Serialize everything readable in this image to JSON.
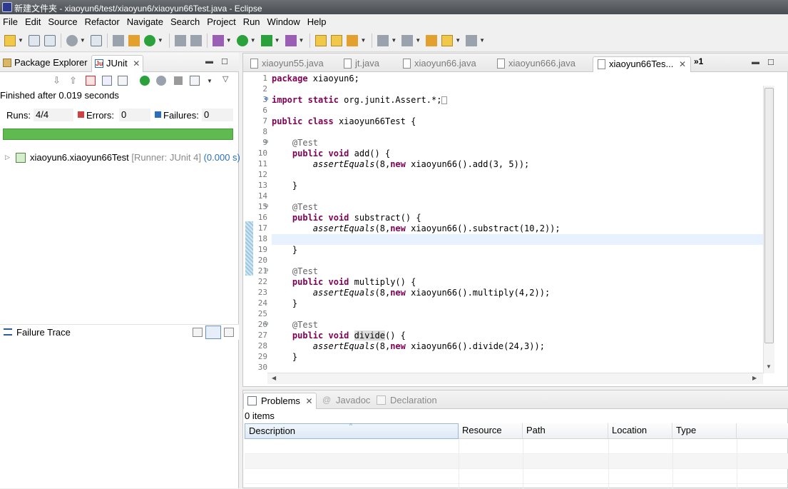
{
  "window": {
    "title": "新建文件夹 - xiaoyun6/test/xiaoyun6/xiaoyun66Test.java - Eclipse"
  },
  "menu": [
    "File",
    "Edit",
    "Source",
    "Refactor",
    "Navigate",
    "Search",
    "Project",
    "Run",
    "Window",
    "Help"
  ],
  "left_tabs": {
    "package_explorer": "Package Explorer",
    "junit": "JUnit"
  },
  "junit": {
    "status": "Finished after 0.019 seconds",
    "runs_label": "Runs:",
    "runs_value": "4/4",
    "errors_label": "Errors:",
    "errors_value": "0",
    "failures_label": "Failures:",
    "failures_value": "0",
    "progress_color": "#5fbb4f",
    "progress_fraction": 1.0,
    "test_name": "xiaoyun6.xiaoyun66Test",
    "test_runner": "[Runner: JUnit 4]",
    "test_time": "(0.000 s)",
    "failure_trace_label": "Failure Trace"
  },
  "editor_tabs": [
    "xiaoyun55.java",
    "jt.java",
    "xiaoyun66.java",
    "xiaoyun666.java",
    "xiaoyun66Tes..."
  ],
  "editor_overflow": "»1",
  "code_lines": [
    {
      "n": "1",
      "t": "package xiaoyun6;"
    },
    {
      "n": "2",
      "t": ""
    },
    {
      "n": "3",
      "t": "import static org.junit.Assert.*;"
    },
    {
      "n": "6",
      "t": ""
    },
    {
      "n": "7",
      "t": "public class xiaoyun66Test {"
    },
    {
      "n": "8",
      "t": ""
    },
    {
      "n": "9",
      "t": "    @Test"
    },
    {
      "n": "10",
      "t": "    public void add() {"
    },
    {
      "n": "11",
      "t": "        assertEquals(8,new xiaoyun66().add(3, 5));"
    },
    {
      "n": "12",
      "t": ""
    },
    {
      "n": "13",
      "t": "    }"
    },
    {
      "n": "14",
      "t": ""
    },
    {
      "n": "15",
      "t": "    @Test"
    },
    {
      "n": "16",
      "t": "    public void substract() {"
    },
    {
      "n": "17",
      "t": "        assertEquals(8,new xiaoyun66().substract(10,2));"
    },
    {
      "n": "18",
      "t": ""
    },
    {
      "n": "19",
      "t": "    }"
    },
    {
      "n": "20",
      "t": ""
    },
    {
      "n": "21",
      "t": "    @Test"
    },
    {
      "n": "22",
      "t": "    public void multiply() {"
    },
    {
      "n": "23",
      "t": "        assertEquals(8,new xiaoyun66().multiply(4,2));"
    },
    {
      "n": "24",
      "t": "    }"
    },
    {
      "n": "25",
      "t": ""
    },
    {
      "n": "26",
      "t": "    @Test"
    },
    {
      "n": "27",
      "t": "    public void divide() {"
    },
    {
      "n": "28",
      "t": "        assertEquals(8,new xiaoyun66().divide(24,3));"
    },
    {
      "n": "29",
      "t": "    }"
    },
    {
      "n": "30",
      "t": ""
    }
  ],
  "bottom_tabs": {
    "problems": "Problems",
    "javadoc": "Javadoc",
    "declaration": "Declaration"
  },
  "problems": {
    "count": "0 items",
    "columns": [
      "Description",
      "Resource",
      "Path",
      "Location",
      "Type"
    ]
  }
}
